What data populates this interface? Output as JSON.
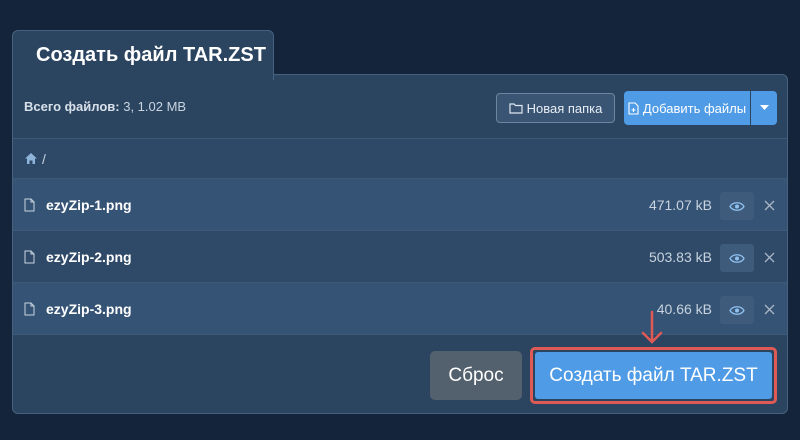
{
  "header": {
    "tab_title": "Создать файл TAR.ZST"
  },
  "toolbar": {
    "summary_label": "Всего файлов:",
    "summary_value": "3, 1.02 MB",
    "new_folder_label": "Новая папка",
    "add_files_label": "Добавить файлы"
  },
  "breadcrumb": {
    "separator": "/"
  },
  "files": [
    {
      "name": "ezyZip-1.png",
      "size": "471.07 kB"
    },
    {
      "name": "ezyZip-2.png",
      "size": "503.83 kB"
    },
    {
      "name": "ezyZip-3.png",
      "size": "40.66 kB"
    }
  ],
  "actions": {
    "reset_label": "Сброс",
    "create_label": "Создать файл TAR.ZST"
  },
  "colors": {
    "background": "#14243a",
    "panel": "#2b4561",
    "accent": "#4f9be6",
    "highlight": "#e05a55",
    "reset": "#53606d"
  },
  "icons": [
    "folder-icon",
    "file-plus-icon",
    "caret-down-icon",
    "home-icon",
    "file-icon",
    "eye-icon",
    "close-icon",
    "arrow-down-icon"
  ]
}
